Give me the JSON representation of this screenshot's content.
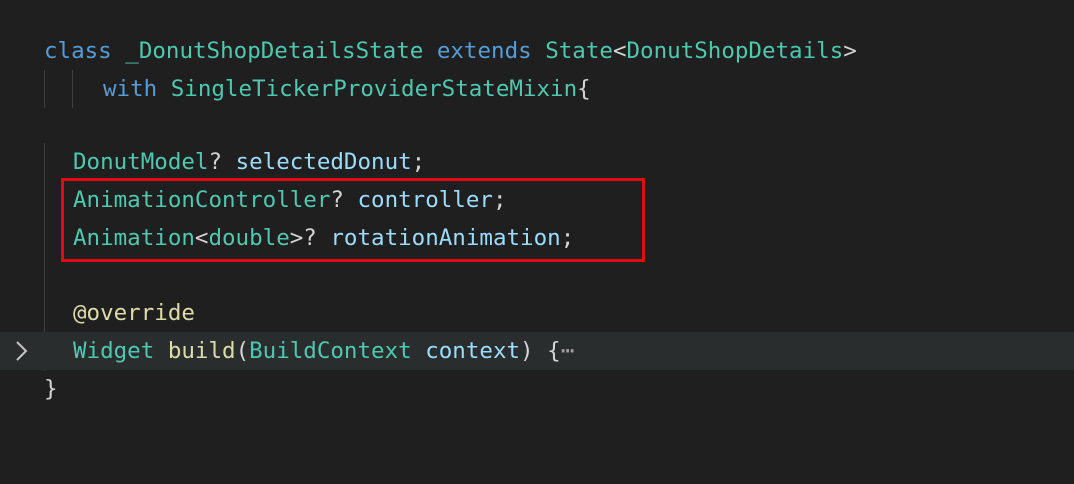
{
  "code": {
    "line1": {
      "kw_class": "class",
      "class_name": "_DonutShopDetailsState",
      "kw_extends": "extends",
      "base_type": "State",
      "lt": "<",
      "type_arg": "DonutShopDetails",
      "gt": ">"
    },
    "line2": {
      "kw_with": "with",
      "mixin": "SingleTickerProviderStateMixin",
      "brace": "{"
    },
    "line4": {
      "type": "DonutModel",
      "q": "?",
      "name": "selectedDonut",
      "semi": ";"
    },
    "line5": {
      "type": "AnimationController",
      "q": "?",
      "name": "controller",
      "semi": ";"
    },
    "line6": {
      "type": "Animation",
      "lt": "<",
      "type_arg": "double",
      "gt_q": ">?",
      "name": "rotationAnimation",
      "semi": ";"
    },
    "line8": {
      "annotation": "@override"
    },
    "line9": {
      "type": "Widget",
      "method": "build",
      "lparen": "(",
      "param_type": "BuildContext",
      "param_name": "context",
      "rparen": ")",
      "brace": "{",
      "collapsed": "⋯"
    },
    "line10": {
      "brace": "}"
    }
  },
  "icons": {
    "fold": "chevron-right-icon"
  },
  "colors": {
    "background": "#1f1f1f",
    "current_line": "#2a2d2e",
    "keyword": "#569cd6",
    "type": "#4ec9b0",
    "identifier": "#9cdcfe",
    "function": "#dcdcaa",
    "highlight_box": "#e10b17"
  }
}
